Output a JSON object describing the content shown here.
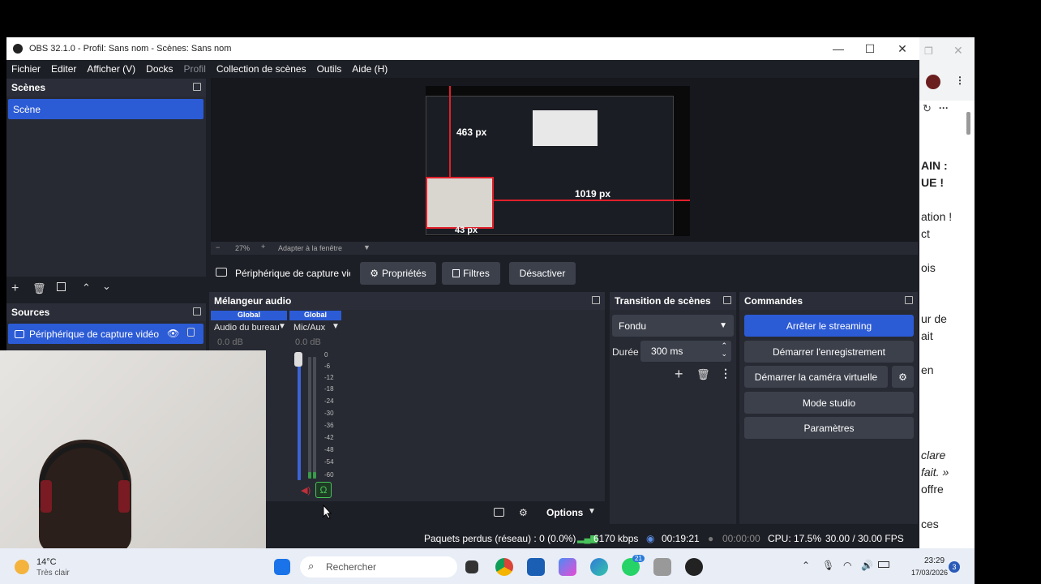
{
  "window": {
    "title": "OBS 32.1.0 - Profil: Sans nom - Scènes: Sans nom",
    "minimize": "—",
    "maximize": "☐",
    "close": "✕"
  },
  "menu": [
    "Fichier",
    "Editer",
    "Afficher (V)",
    "Docks",
    "Profil",
    "Collection de scènes",
    "Outils",
    "Aide (H)"
  ],
  "scenes": {
    "title": "Scènes",
    "items": [
      "Scène"
    ]
  },
  "sources": {
    "title": "Sources",
    "items": [
      "Périphérique de capture vidéo"
    ]
  },
  "preview": {
    "measure_top": "463 px",
    "measure_right": "1019 px",
    "measure_bottom": "43 px",
    "zoom": "27%",
    "fit": "Adapter à la fenêtre"
  },
  "source_toolbar": {
    "source_name": "Périphérique de capture vic",
    "properties": "Propriétés",
    "filters": "Filtres",
    "deactivate": "Désactiver"
  },
  "mixer": {
    "title": "Mélangeur audio",
    "channels": [
      {
        "badge": "Global",
        "name": "Audio du bureau",
        "db": "0.0 dB"
      },
      {
        "badge": "Global",
        "name": "Mic/Aux",
        "db": "0.0 dB"
      }
    ],
    "scale": [
      "0",
      "-6",
      "-12",
      "-18",
      "-24",
      "-30",
      "-36",
      "-42",
      "-48",
      "-54",
      "-60"
    ],
    "options": "Options"
  },
  "transitions": {
    "title": "Transition de scènes",
    "selected": "Fondu",
    "duration_label": "Durée",
    "duration_value": "300 ms"
  },
  "controls": {
    "title": "Commandes",
    "stop_stream": "Arrêter le streaming",
    "start_record": "Démarrer l'enregistrement",
    "start_vcam": "Démarrer la caméra virtuelle",
    "studio_mode": "Mode studio",
    "settings": "Paramètres"
  },
  "status": {
    "dropped": "Paquets perdus (réseau) : 0 (0.0%)",
    "bitrate": "6170 kbps",
    "stream_time": "00:19:21",
    "record_time": "00:00:00",
    "cpu": "CPU: 17.5%",
    "fps": "30.00 / 30.00 FPS"
  },
  "browser_snippets": [
    "AIN :",
    "UE !",
    "ation !",
    "ct",
    "ois",
    "ur de",
    "ait",
    "en",
    "clare",
    "fait. »",
    "offre",
    "ces"
  ],
  "taskbar": {
    "temp": "14°C",
    "weather": "Très clair",
    "search_placeholder": "Rechercher",
    "time": "23:29",
    "date": "17/03/2026",
    "whatsapp_badge": "21",
    "notif_count": "3"
  },
  "colors": {
    "accent": "#2c5bd6",
    "panel": "#272a33",
    "header": "#2b2e38",
    "app_bg": "#1d1f26"
  }
}
